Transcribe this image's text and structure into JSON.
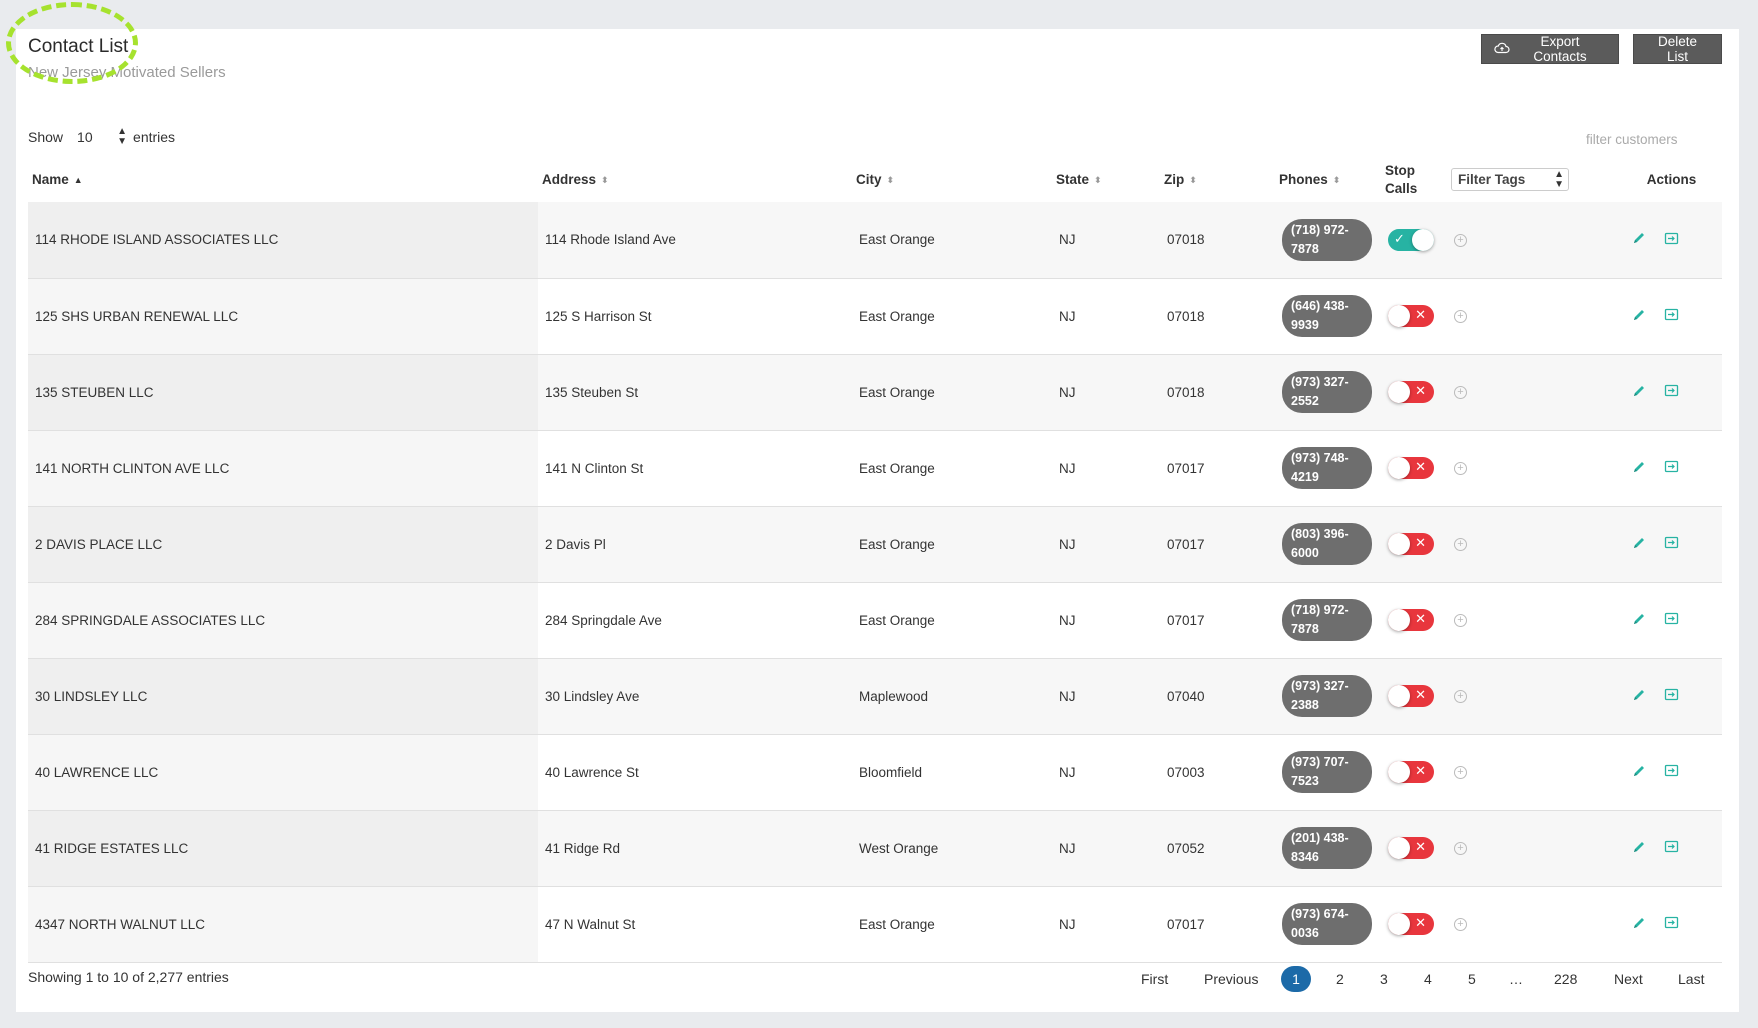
{
  "header": {
    "title": "Contact List",
    "subtitle": "New Jersey Motivated Sellers",
    "export_label": "Export Contacts",
    "delete_label": "Delete List"
  },
  "controls": {
    "show_label": "Show",
    "entries_value": "10",
    "entries_label": "entries",
    "filter_placeholder": "filter customers"
  },
  "columns": {
    "name": "Name",
    "address": "Address",
    "city": "City",
    "state": "State",
    "zip": "Zip",
    "phones": "Phones",
    "stop_calls_1": "Stop",
    "stop_calls_2": "Calls",
    "filter_tags": "Filter Tags",
    "actions": "Actions"
  },
  "rows": [
    {
      "name": "114 RHODE ISLAND ASSOCIATES LLC",
      "address": "114 Rhode Island Ave",
      "city": "East Orange",
      "state": "NJ",
      "zip": "07018",
      "phone_1": "(718) 972-",
      "phone_2": "7878",
      "stop_calls": true
    },
    {
      "name": "125 SHS URBAN RENEWAL LLC",
      "address": "125 S Harrison St",
      "city": "East Orange",
      "state": "NJ",
      "zip": "07018",
      "phone_1": "(646) 438-",
      "phone_2": "9939",
      "stop_calls": false
    },
    {
      "name": "135 STEUBEN LLC",
      "address": "135 Steuben St",
      "city": "East Orange",
      "state": "NJ",
      "zip": "07018",
      "phone_1": "(973) 327-",
      "phone_2": "2552",
      "stop_calls": false
    },
    {
      "name": "141 NORTH CLINTON AVE LLC",
      "address": "141 N Clinton St",
      "city": "East Orange",
      "state": "NJ",
      "zip": "07017",
      "phone_1": "(973) 748-",
      "phone_2": "4219",
      "stop_calls": false
    },
    {
      "name": "2 DAVIS PLACE LLC",
      "address": "2 Davis Pl",
      "city": "East Orange",
      "state": "NJ",
      "zip": "07017",
      "phone_1": "(803) 396-",
      "phone_2": "6000",
      "stop_calls": false
    },
    {
      "name": "284 SPRINGDALE ASSOCIATES LLC",
      "address": "284 Springdale Ave",
      "city": "East Orange",
      "state": "NJ",
      "zip": "07017",
      "phone_1": "(718) 972-",
      "phone_2": "7878",
      "stop_calls": false
    },
    {
      "name": "30 LINDSLEY LLC",
      "address": "30 Lindsley Ave",
      "city": "Maplewood",
      "state": "NJ",
      "zip": "07040",
      "phone_1": "(973) 327-",
      "phone_2": "2388",
      "stop_calls": false
    },
    {
      "name": "40 LAWRENCE LLC",
      "address": "40 Lawrence St",
      "city": "Bloomfield",
      "state": "NJ",
      "zip": "07003",
      "phone_1": "(973) 707-",
      "phone_2": "7523",
      "stop_calls": false
    },
    {
      "name": "41 RIDGE ESTATES LLC",
      "address": "41 Ridge Rd",
      "city": "West Orange",
      "state": "NJ",
      "zip": "07052",
      "phone_1": "(201) 438-",
      "phone_2": "8346",
      "stop_calls": false
    },
    {
      "name": "4347 NORTH WALNUT LLC",
      "address": "47 N Walnut St",
      "city": "East Orange",
      "state": "NJ",
      "zip": "07017",
      "phone_1": "(973) 674-",
      "phone_2": "0036",
      "stop_calls": false
    }
  ],
  "footer": {
    "info": "Showing 1 to 10 of 2,277 entries",
    "pagination": {
      "first": "First",
      "previous": "Previous",
      "pages": [
        "1",
        "2",
        "3",
        "4",
        "5"
      ],
      "ellipsis": "…",
      "last_page": "228",
      "next": "Next",
      "last": "Last",
      "current": "1"
    }
  },
  "colors": {
    "accent": "#27b3a3",
    "danger": "#e8363d",
    "primary": "#1c6aa8",
    "highlight": "#a6e22e"
  },
  "icons": {
    "cloud": "cloud-upload-icon",
    "edit": "pencil-icon",
    "open": "open-contact-icon",
    "add": "add-tag-icon"
  }
}
